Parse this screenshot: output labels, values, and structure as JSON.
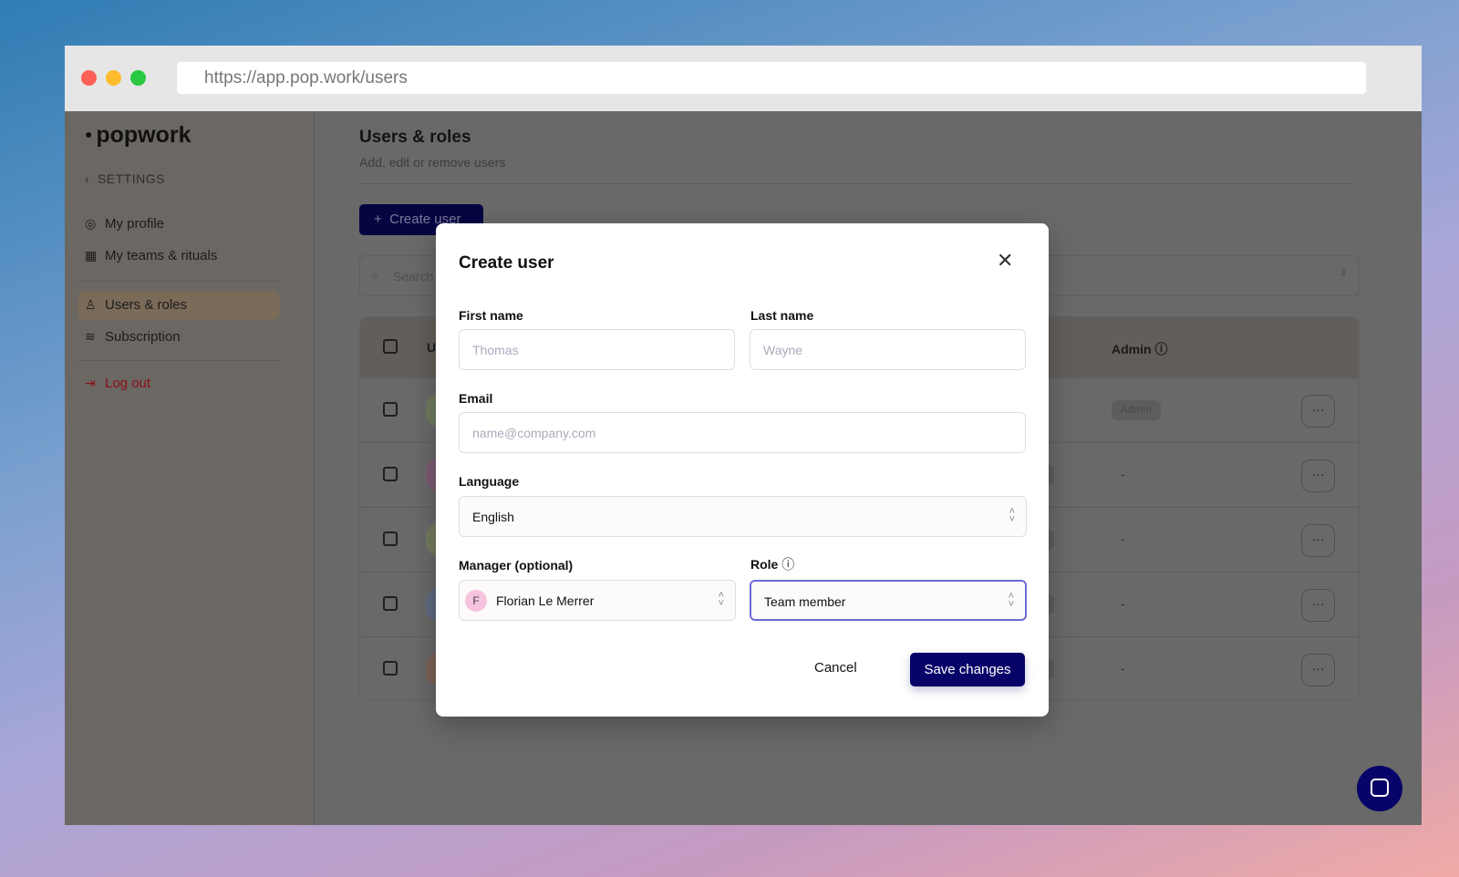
{
  "browser": {
    "url": "https://app.pop.work/users"
  },
  "sidebar": {
    "logo": "popwork",
    "back_label": "SETTINGS",
    "items": [
      {
        "label": "My profile",
        "icon": "user-circle-icon"
      },
      {
        "label": "My teams & rituals",
        "icon": "calendar-icon"
      },
      {
        "label": "Users & roles",
        "icon": "user-icon",
        "active": true
      },
      {
        "label": "Subscription",
        "icon": "layers-icon"
      },
      {
        "label": "Log out",
        "icon": "logout-icon"
      }
    ]
  },
  "page": {
    "title": "Users & roles",
    "subtitle": "Add, edit or remove users",
    "create_label": "Create user",
    "search_placeholder": "Search",
    "table": {
      "header_user": "U",
      "header_admin": "Admin",
      "rows": [
        {
          "role": "",
          "admin": "Admin",
          "avatar_color": "#6e7a5e"
        },
        {
          "role": "mber",
          "admin": "-",
          "avatar_color": "#7a5a72"
        },
        {
          "role": "mber",
          "admin": "-",
          "avatar_color": "#727a5e"
        },
        {
          "role": "mber",
          "admin": "-",
          "avatar_color": "#5e6a80"
        },
        {
          "role": "mber",
          "admin": "-",
          "avatar_color": "#7a6258"
        }
      ]
    }
  },
  "modal": {
    "title": "Create user",
    "first_name_label": "First name",
    "first_name_placeholder": "Thomas",
    "last_name_label": "Last name",
    "last_name_placeholder": "Wayne",
    "email_label": "Email",
    "email_placeholder": "name@company.com",
    "language_label": "Language",
    "language_value": "English",
    "manager_label": "Manager (optional)",
    "manager_initial": "F",
    "manager_value": "Florian Le Merrer",
    "role_label": "Role",
    "role_value": "Team member",
    "cancel_label": "Cancel",
    "save_label": "Save changes"
  },
  "colors": {
    "primary": "#070368",
    "focus": "#6b6bd6",
    "logout": "#b0101a"
  }
}
